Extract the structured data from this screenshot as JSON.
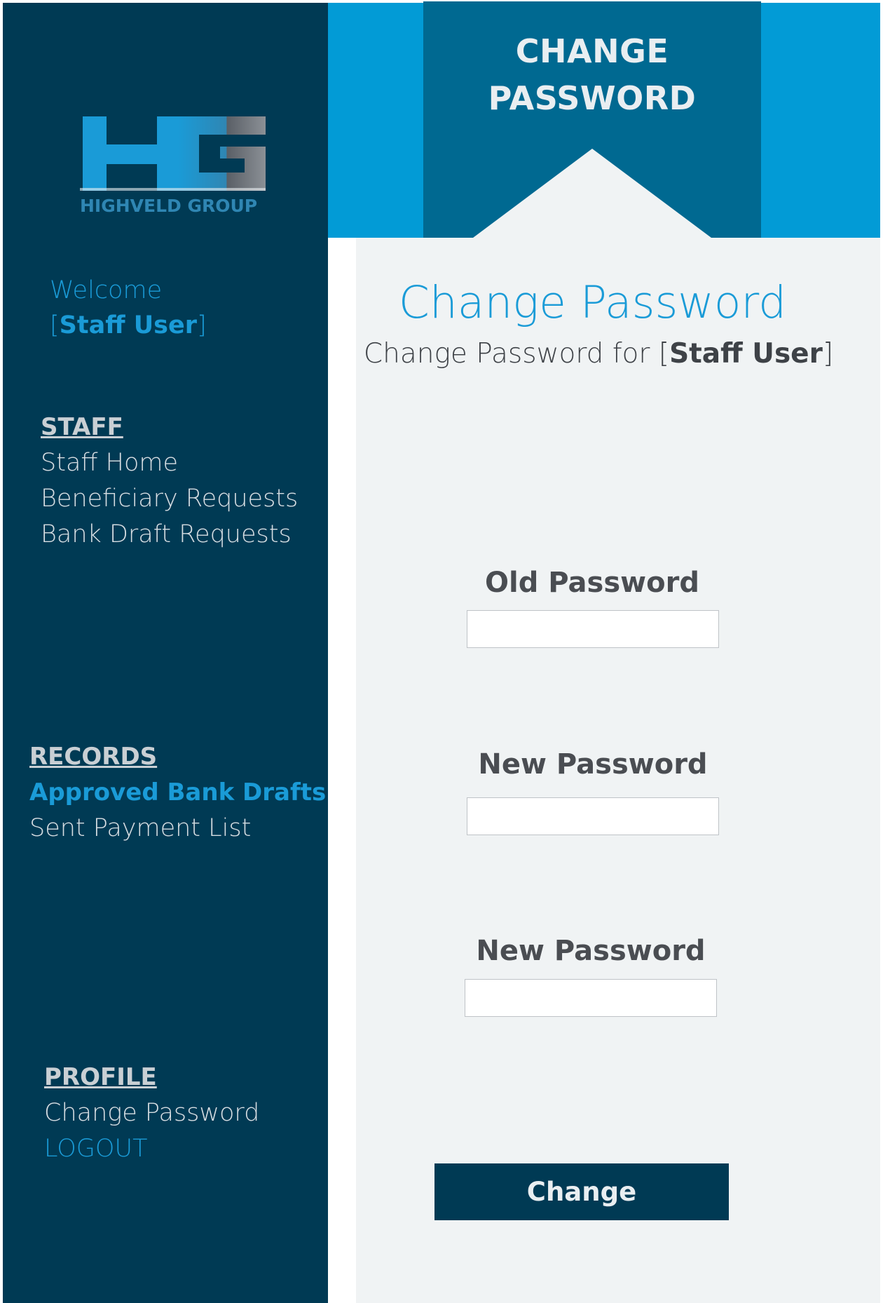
{
  "brand": {
    "logo_letters": "HG",
    "logo_text": "HIGHVELD GROUP"
  },
  "sidebar": {
    "welcome": "Welcome",
    "user_bracket_open": "[",
    "user_name": "Staff User",
    "user_bracket_close": "]",
    "staff": {
      "heading": "STAFF",
      "items": [
        "Staff Home",
        "Beneficiary Requests",
        "Bank Draft Requests"
      ]
    },
    "records": {
      "heading": "RECORDS",
      "items": [
        "Approved Bank Drafts",
        "Sent Payment List"
      ]
    },
    "profile": {
      "heading": "PROFILE",
      "items": [
        "Change Password",
        "LOGOUT"
      ]
    }
  },
  "banner": {
    "line1": "CHANGE",
    "line2": "PASSWORD"
  },
  "main": {
    "title": "Change Password",
    "subtitle_prefix": "Change Password for [",
    "subtitle_user": "Staff User",
    "subtitle_suffix": "]",
    "fields": [
      {
        "label": "Old Password",
        "value": ""
      },
      {
        "label": "New Password",
        "value": ""
      },
      {
        "label": "New Password",
        "value": ""
      }
    ],
    "submit_label": "Change"
  },
  "colors": {
    "sidebar_bg": "#003a54",
    "accent": "#1a9bd7",
    "top_band": "#029bd6",
    "banner": "#006991",
    "main_bg": "#f0f3f4",
    "button_bg": "#003a54"
  }
}
